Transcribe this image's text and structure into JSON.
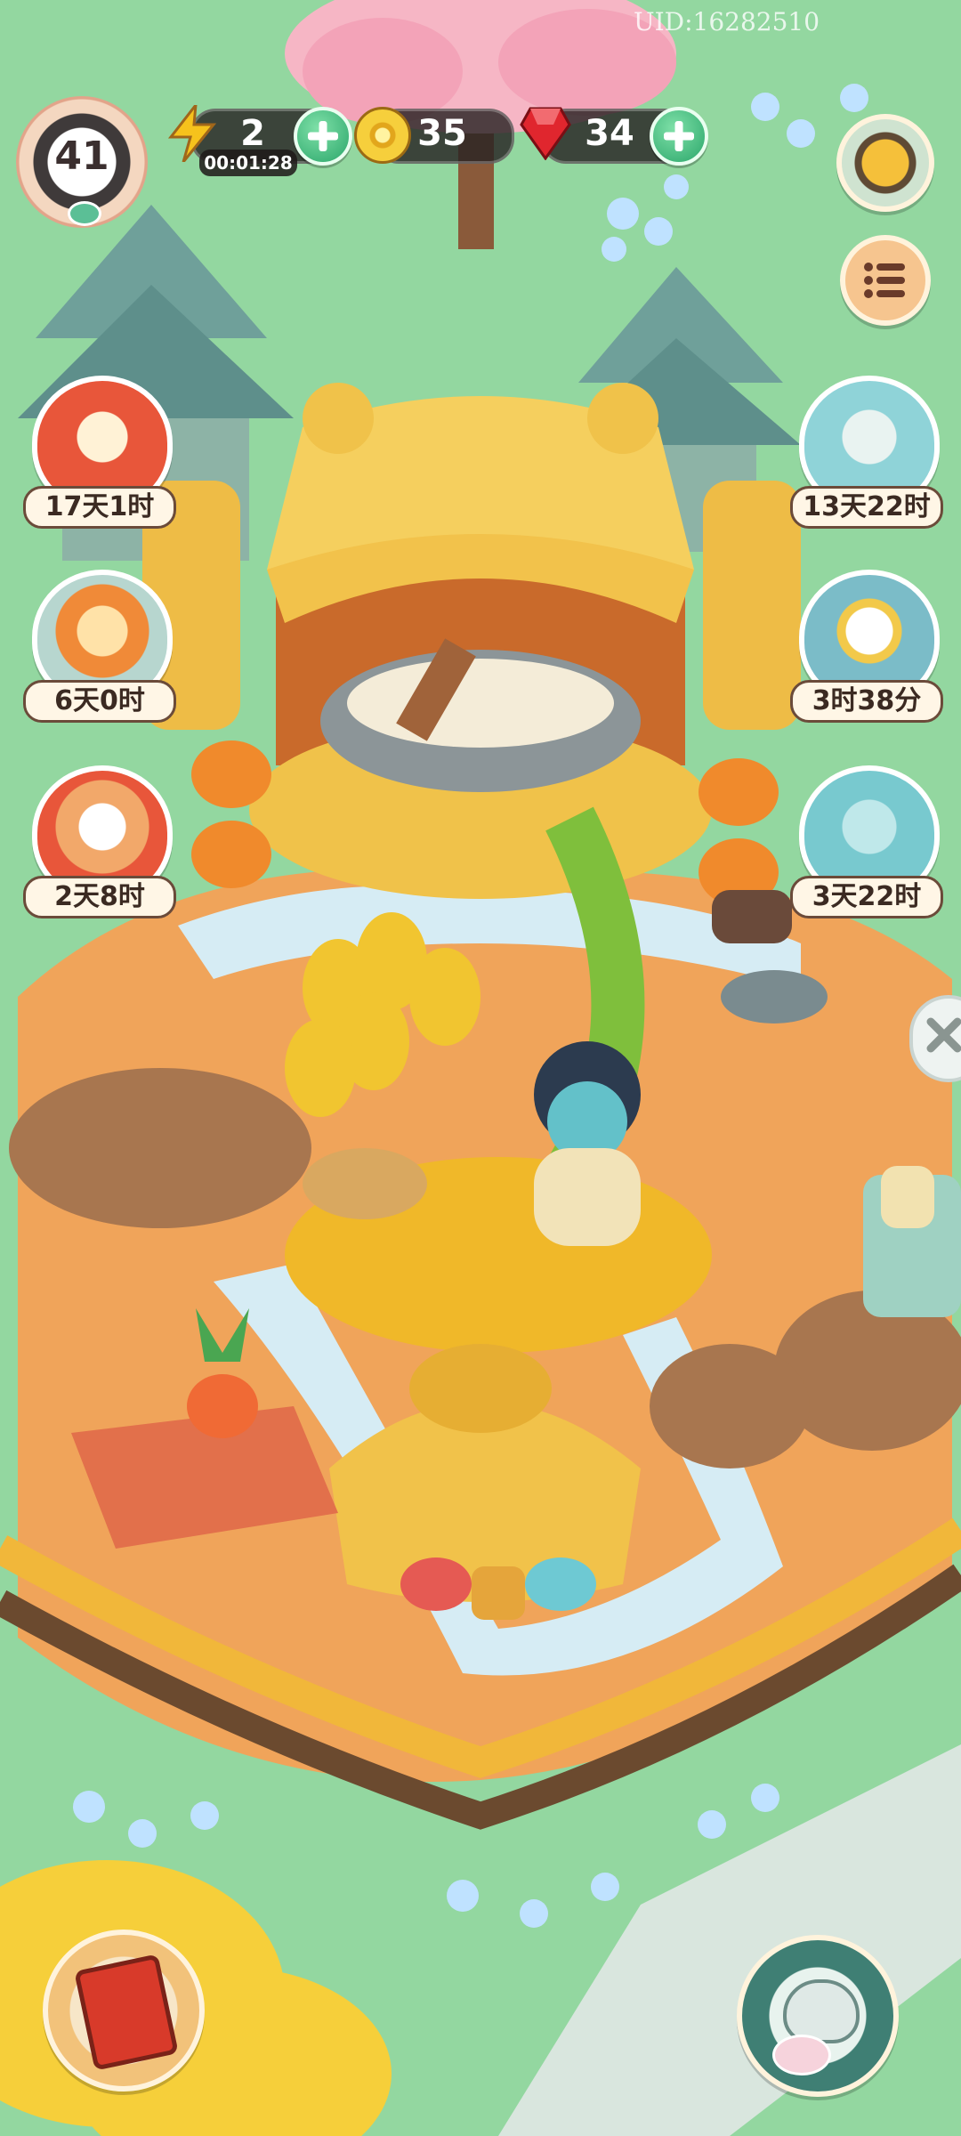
{
  "uid": "UID:16282510",
  "player": {
    "level": "41"
  },
  "resources": {
    "energy": {
      "value": "2",
      "timer": "00:01:28",
      "icon": "lightning-icon"
    },
    "coins": {
      "value": "35",
      "icon": "coin-icon"
    },
    "gems": {
      "value": "34",
      "icon": "ruby-icon"
    }
  },
  "events": {
    "left": [
      {
        "name": "event-book-festival",
        "time": "17天1时",
        "color": "#e8563a"
      },
      {
        "name": "event-autumn-lion",
        "time": "6天0时",
        "color": "#f08a38"
      },
      {
        "name": "event-lucky-cat",
        "time": "2天8时",
        "color": "#f2a86a"
      }
    ],
    "right": [
      {
        "name": "event-spirit-cat-bath",
        "time": "13天22时",
        "color": "#8fd3d8"
      },
      {
        "name": "event-snow-mountain",
        "time": "3时38分",
        "color": "#7bbcc8"
      },
      {
        "name": "event-gift-box-bear",
        "time": "3天22时",
        "color": "#78c9cf"
      }
    ]
  },
  "colors": {
    "grass": "#8fd49a",
    "thatch": "#f0c24a",
    "water": "#cfe6f0",
    "orange_ground": "#f2a35a",
    "fence": "#6b4a2f"
  }
}
